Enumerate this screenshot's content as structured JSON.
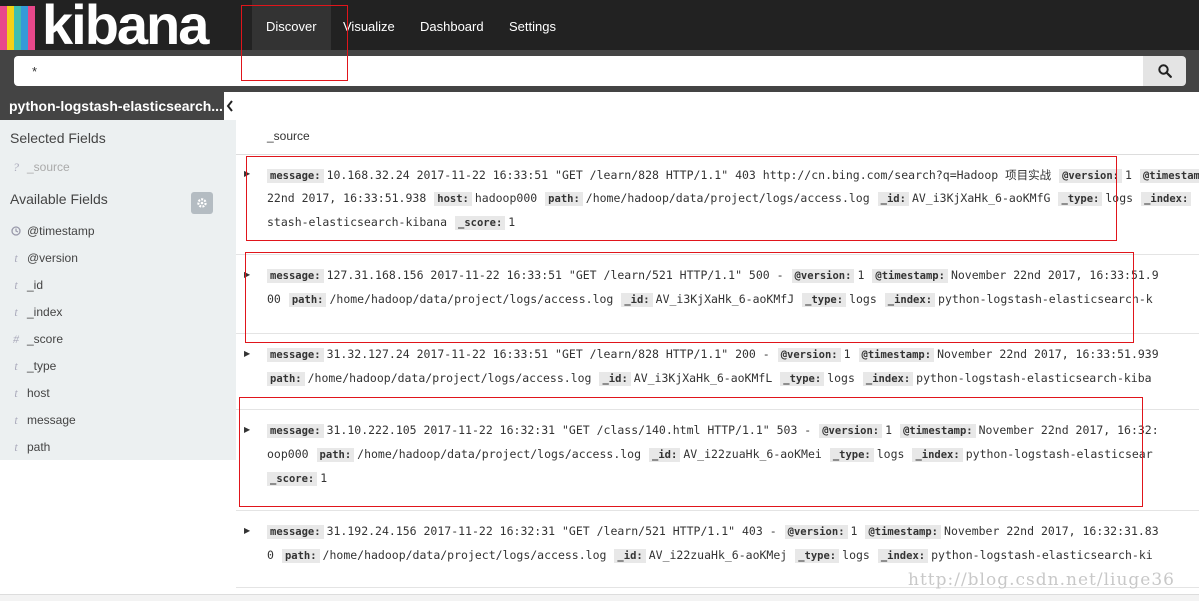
{
  "app": {
    "logo_text": "kibana"
  },
  "nav": {
    "tabs": [
      {
        "label": "Discover",
        "active": true
      },
      {
        "label": "Visualize",
        "active": false
      },
      {
        "label": "Dashboard",
        "active": false
      },
      {
        "label": "Settings",
        "active": false
      }
    ]
  },
  "search": {
    "value": "*"
  },
  "sidebar": {
    "index_name": "python-logstash-elasticsearch...",
    "selected_title": "Selected Fields",
    "selected_fields": [
      {
        "type": "?",
        "name": "_source"
      }
    ],
    "available_title": "Available Fields",
    "available_fields": [
      {
        "type": "clock",
        "name": "@timestamp"
      },
      {
        "type": "t",
        "name": "@version"
      },
      {
        "type": "t",
        "name": "_id"
      },
      {
        "type": "t",
        "name": "_index"
      },
      {
        "type": "#",
        "name": "_score"
      },
      {
        "type": "t",
        "name": "_type"
      },
      {
        "type": "t",
        "name": "host"
      },
      {
        "type": "t",
        "name": "message"
      },
      {
        "type": "t",
        "name": "path"
      }
    ]
  },
  "results": {
    "column_header": "_source",
    "docs": [
      {
        "lines": [
          [
            [
              "message:",
              "10.168.32.24 2017-11-22 16:33:51 \"GET /learn/828 HTTP/1.1\" 403 http://cn.bing.com/search?q=Hadoop 项目实战"
            ],
            [
              "@version:",
              "1"
            ],
            [
              "@timestamp:",
              ""
            ]
          ],
          [
            [
              "",
              "22nd 2017, 16:33:51.938"
            ],
            [
              "host:",
              "hadoop000"
            ],
            [
              "path:",
              "/home/hadoop/data/project/logs/access.log"
            ],
            [
              "_id:",
              "AV_i3KjXaHk_6-aoKMfG"
            ],
            [
              "_type:",
              "logs"
            ],
            [
              "_index:",
              ""
            ]
          ],
          [
            [
              "",
              "stash-elasticsearch-kibana"
            ],
            [
              "_score:",
              "1"
            ]
          ]
        ]
      },
      {
        "lines": [
          [
            [
              "message:",
              "127.31.168.156 2017-11-22 16:33:51 \"GET /learn/521 HTTP/1.1\" 500 -"
            ],
            [
              "@version:",
              "1"
            ],
            [
              "@timestamp:",
              "November 22nd 2017, 16:33:51.9"
            ]
          ],
          [
            [
              "",
              "00"
            ],
            [
              "path:",
              "/home/hadoop/data/project/logs/access.log"
            ],
            [
              "_id:",
              "AV_i3KjXaHk_6-aoKMfJ"
            ],
            [
              "_type:",
              "logs"
            ],
            [
              "_index:",
              "python-logstash-elasticsearch-k"
            ]
          ]
        ]
      },
      {
        "lines": [
          [
            [
              "message:",
              "31.32.127.24 2017-11-22 16:33:51 \"GET /learn/828 HTTP/1.1\" 200 -"
            ],
            [
              "@version:",
              "1"
            ],
            [
              "@timestamp:",
              "November 22nd 2017, 16:33:51.939"
            ]
          ],
          [
            [
              "path:",
              "/home/hadoop/data/project/logs/access.log"
            ],
            [
              "_id:",
              "AV_i3KjXaHk_6-aoKMfL"
            ],
            [
              "_type:",
              "logs"
            ],
            [
              "_index:",
              "python-logstash-elasticsearch-kiba"
            ]
          ]
        ]
      },
      {
        "lines": [
          [
            [
              "message:",
              "31.10.222.105 2017-11-22 16:32:31 \"GET /class/140.html HTTP/1.1\" 503 -"
            ],
            [
              "@version:",
              "1"
            ],
            [
              "@timestamp:",
              "November 22nd 2017, 16:32:"
            ]
          ],
          [
            [
              "",
              "oop000"
            ],
            [
              "path:",
              "/home/hadoop/data/project/logs/access.log"
            ],
            [
              "_id:",
              "AV_i22zuaHk_6-aoKMei"
            ],
            [
              "_type:",
              "logs"
            ],
            [
              "_index:",
              "python-logstash-elasticsear"
            ]
          ],
          [
            [
              "_score:",
              "1"
            ]
          ]
        ]
      },
      {
        "lines": [
          [
            [
              "message:",
              "31.192.24.156 2017-11-22 16:32:31 \"GET /learn/521 HTTP/1.1\" 403 -"
            ],
            [
              "@version:",
              "1"
            ],
            [
              "@timestamp:",
              "November 22nd 2017, 16:32:31.83"
            ]
          ],
          [
            [
              "",
              "0"
            ],
            [
              "path:",
              "/home/hadoop/data/project/logs/access.log"
            ],
            [
              "_id:",
              "AV_i22zuaHk_6-aoKMej"
            ],
            [
              "_type:",
              "logs"
            ],
            [
              "_index:",
              "python-logstash-elasticsearch-ki"
            ]
          ]
        ]
      }
    ]
  },
  "watermark": "http://blog.csdn.net/liuge36",
  "colors": {
    "navbar": "#222222",
    "searchbar": "#444444",
    "sidebar": "#ecf0f1",
    "annotation": "#e0151b"
  }
}
